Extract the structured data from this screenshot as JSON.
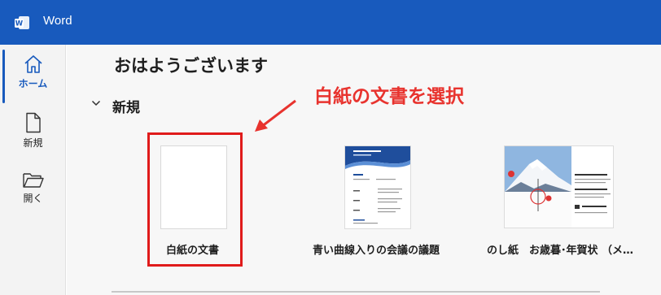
{
  "app": {
    "title": "Word",
    "logo_icon": "word-logo-icon",
    "accent_color": "#185abd"
  },
  "sidebar": {
    "items": [
      {
        "label": "ホーム",
        "icon": "home-icon",
        "active": true
      },
      {
        "label": "新規",
        "icon": "new-document-icon",
        "active": false
      },
      {
        "label": "開く",
        "icon": "open-folder-icon",
        "active": false
      }
    ]
  },
  "main": {
    "greeting": "おはようございます",
    "section": {
      "title": "新規",
      "icon": "chevron-down-icon"
    },
    "annotation": {
      "text": "白紙の文書を選択",
      "color": "#e8332e"
    },
    "templates": [
      {
        "label": "白紙の文書",
        "selected": true
      },
      {
        "label": "青い曲線入りの会議の議題",
        "selected": false
      },
      {
        "label": "のし紙　お歳暮･年賀状 （メ…",
        "selected": false
      }
    ]
  }
}
